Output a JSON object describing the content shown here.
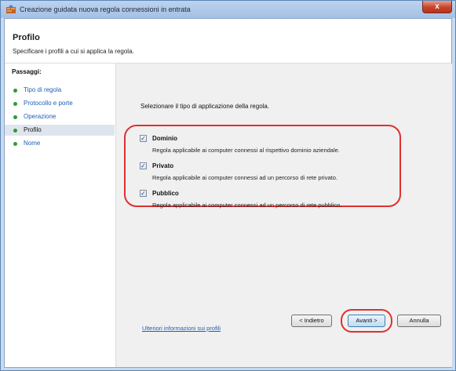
{
  "window": {
    "title": "Creazione guidata nuova regola connessioni in entrata",
    "close_label": "x"
  },
  "header": {
    "title": "Profilo",
    "subtitle": "Specificare i profili a cui si applica la regola."
  },
  "sidebar": {
    "title": "Passaggi:",
    "items": [
      {
        "label": "Tipo di regola"
      },
      {
        "label": "Protocollo e porte"
      },
      {
        "label": "Operazione"
      },
      {
        "label": "Profilo"
      },
      {
        "label": "Nome"
      }
    ],
    "current_index": 3
  },
  "main": {
    "instruction": "Selezionare il tipo di applicazione della regola.",
    "options": [
      {
        "name": "Dominio",
        "checked": true,
        "description": "Regola applicabile ai computer connessi al rispettivo dominio aziendale."
      },
      {
        "name": "Privato",
        "checked": true,
        "description": "Regola applicabile ai computer connessi ad un percorso di rete privato."
      },
      {
        "name": "Pubblico",
        "checked": true,
        "description": "Regola applicabile ai computer connessi ad un percorso di rete pubblico."
      }
    ],
    "checkmark": "✓",
    "link": "Ulteriori informazioni sui profili"
  },
  "buttons": {
    "back": "< Indietro",
    "next": "Avanti >",
    "cancel": "Annulla"
  },
  "colors": {
    "accent_link": "#1f5fb5",
    "highlight_annotation": "#e03030",
    "step_dot": "#2e9a3a"
  }
}
